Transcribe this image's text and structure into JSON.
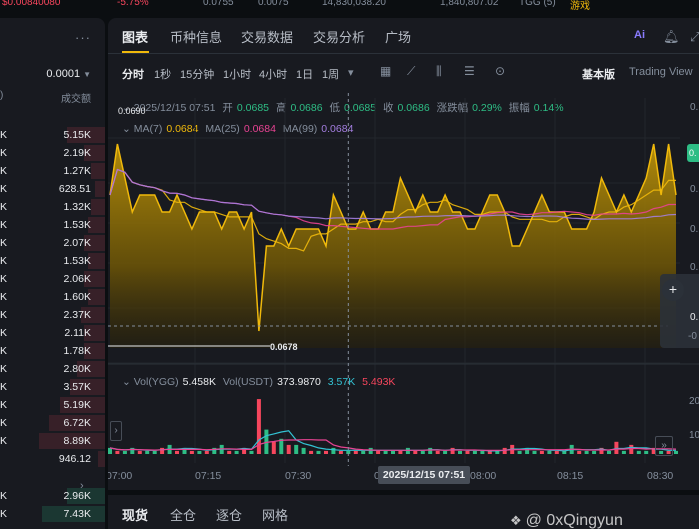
{
  "top_strip": {
    "items": [
      "$0.00840080",
      "-5.75%",
      "0.0755",
      "0.0075",
      "14,830,038.20",
      "1,840,807.02",
      "TGG (5)",
      "游戏"
    ]
  },
  "order_book": {
    "menu_dots": "···",
    "step": "0.0001",
    "column_header_left": ")",
    "column_header_right": "成交额",
    "sell_rows": [
      {
        "left": "K",
        "value": "5.15K"
      },
      {
        "left": "K",
        "value": "2.19K"
      },
      {
        "left": "K",
        "value": "1.27K"
      },
      {
        "left": "K",
        "value": "628.51"
      },
      {
        "left": "K",
        "value": "1.32K"
      },
      {
        "left": "K",
        "value": "1.53K"
      },
      {
        "left": "K",
        "value": "2.07K"
      },
      {
        "left": "K",
        "value": "1.53K"
      },
      {
        "left": "K",
        "value": "2.06K"
      },
      {
        "left": "K",
        "value": "1.60K"
      },
      {
        "left": "K",
        "value": "2.37K"
      },
      {
        "left": "K",
        "value": "2.11K"
      },
      {
        "left": "K",
        "value": "1.78K"
      },
      {
        "left": "K",
        "value": "2.80K"
      },
      {
        "left": "K",
        "value": "3.57K"
      },
      {
        "left": "K",
        "value": "5.19K"
      },
      {
        "left": "K",
        "value": "6.72K"
      },
      {
        "left": "K",
        "value": "8.89K"
      },
      {
        "left": "",
        "value": "946.12"
      }
    ],
    "sell_depth": [
      0.55,
      0.3,
      0.2,
      0.15,
      0.2,
      0.25,
      0.3,
      0.25,
      0.3,
      0.25,
      0.35,
      0.3,
      0.3,
      0.4,
      0.5,
      0.65,
      0.8,
      0.95,
      0.1
    ],
    "mid_chevron": "›",
    "buy_rows": [
      {
        "left": "K",
        "value": "2.96K"
      },
      {
        "left": "K",
        "value": "7.43K"
      }
    ],
    "buy_depth": [
      0.55,
      0.9
    ]
  },
  "tabs": {
    "items": [
      "图表",
      "币种信息",
      "交易数据",
      "交易分析",
      "广场"
    ],
    "active": "图表"
  },
  "toolbar": {
    "intervals": [
      "分时",
      "1秒",
      "15分钟",
      "1小时",
      "4小时",
      "1日",
      "1周"
    ],
    "active_interval": "分时",
    "more_caret": "▾",
    "basic_label": "基本版",
    "tradingview_label": "Trading View"
  },
  "legend": {
    "date": "2025/12/15 07:51",
    "open_label": "开",
    "open": "0.0685",
    "high_label": "高",
    "high": "0.0686",
    "low_label": "低",
    "low": "0.0685",
    "close_label": "收",
    "close": "0.0686",
    "change_label": "涨跌幅",
    "change": "0.29%",
    "amp_label": "振幅",
    "amp": "0.14%",
    "ma7_label": "MA(7)",
    "ma7": "0.0684",
    "ma25_label": "MA(25)",
    "ma25": "0.0684",
    "ma99_label": "MA(99)",
    "ma99": "0.0684"
  },
  "price_labels": {
    "max": "0.0690",
    "min": "0.0678"
  },
  "volume_legend": {
    "vol_ygg_label": "Vol(YGG)",
    "vol_ygg": "5.458K",
    "vol_usdt_label": "Vol(USDT)",
    "vol_usdt": "373.9870",
    "ma_a": "3.57K",
    "ma_b": "5.493K"
  },
  "right_axis": {
    "price_digits": [
      "0.",
      "0.",
      "0.",
      "0.",
      "0.",
      "0.",
      "0.",
      "-0"
    ],
    "vol_ticks": [
      "20",
      "10"
    ]
  },
  "time_axis": {
    "labels": [
      "07:00",
      "07:15",
      "07:30",
      "08:00",
      "08:15",
      "08:30"
    ],
    "crosshair": "2025/12/15 07:51",
    "partial_left": "0"
  },
  "bottom_tabs": {
    "items": [
      "现货",
      "全仓",
      "逐仓",
      "网格"
    ],
    "active": "现货"
  },
  "watermark": "@ 0xQingyun",
  "colors": {
    "up": "#2ebd85",
    "down": "#f6465d",
    "accent": "#f0b90b",
    "ma7": "#f0b90b",
    "ma25": "#e84393",
    "ma99": "#a47ee0"
  },
  "chart_data": {
    "type": "area",
    "price_series": [
      0.0686,
      0.0689,
      0.0687,
      0.0685,
      0.0686,
      0.0686,
      0.0686,
      0.0685,
      0.0685,
      0.0686,
      0.0685,
      0.0684,
      0.0685,
      0.0685,
      0.0685,
      0.0684,
      0.0685,
      0.0685,
      0.0684,
      0.0685,
      0.0678,
      0.0683,
      0.0683,
      0.0684,
      0.0683,
      0.0684,
      0.0684,
      0.0684,
      0.0684,
      0.0683,
      0.0686,
      0.0685,
      0.0684,
      0.0684,
      0.0685,
      0.0684,
      0.0684,
      0.0685,
      0.0685,
      0.0687,
      0.0686,
      0.0685,
      0.0686,
      0.0685,
      0.0685,
      0.0686,
      0.0685,
      0.0685,
      0.0684,
      0.0684,
      0.0685,
      0.0686,
      0.0686,
      0.0685,
      0.0683,
      0.0683,
      0.0684,
      0.0685,
      0.0686,
      0.0685,
      0.0685,
      0.0685,
      0.0684,
      0.0684,
      0.0684,
      0.0685,
      0.0687,
      0.0686,
      0.0685,
      0.0686,
      0.0685,
      0.0686,
      0.0687,
      0.0689,
      0.0686,
      0.0689,
      0.0686
    ],
    "volumes": [
      2,
      1,
      1,
      2,
      1,
      1,
      1,
      2,
      3,
      1,
      2,
      1,
      1,
      1,
      2,
      3,
      1,
      1,
      2,
      1,
      18,
      8,
      4,
      5,
      3,
      3,
      2,
      1,
      1,
      1,
      2,
      1,
      1,
      1,
      1,
      2,
      1,
      1,
      1,
      1,
      2,
      1,
      1,
      2,
      1,
      1,
      2,
      1,
      1,
      1,
      1,
      1,
      1,
      2,
      3,
      1,
      2,
      1,
      1,
      1,
      1,
      1,
      3,
      1,
      1,
      1,
      2,
      1,
      4,
      1,
      3,
      1,
      1,
      2,
      1,
      1,
      1
    ],
    "volume_up": [
      true,
      false,
      true,
      true,
      false,
      true,
      true,
      false,
      true,
      false,
      true,
      false,
      true,
      false,
      true,
      true,
      false,
      true,
      false,
      true,
      false,
      true,
      false,
      true,
      false,
      true,
      true,
      false,
      true,
      false,
      true,
      false,
      true,
      false,
      true,
      true,
      false,
      true,
      true,
      false,
      true,
      false,
      true,
      true,
      false,
      true,
      false,
      true,
      false,
      true,
      true,
      false,
      true,
      false,
      false,
      true,
      true,
      true,
      false,
      true,
      false,
      true,
      true,
      false,
      true,
      true,
      false,
      true,
      false,
      true,
      false,
      true,
      true,
      false,
      true,
      false,
      true
    ],
    "ylim": [
      0.0677,
      0.0691
    ],
    "grid": true
  }
}
